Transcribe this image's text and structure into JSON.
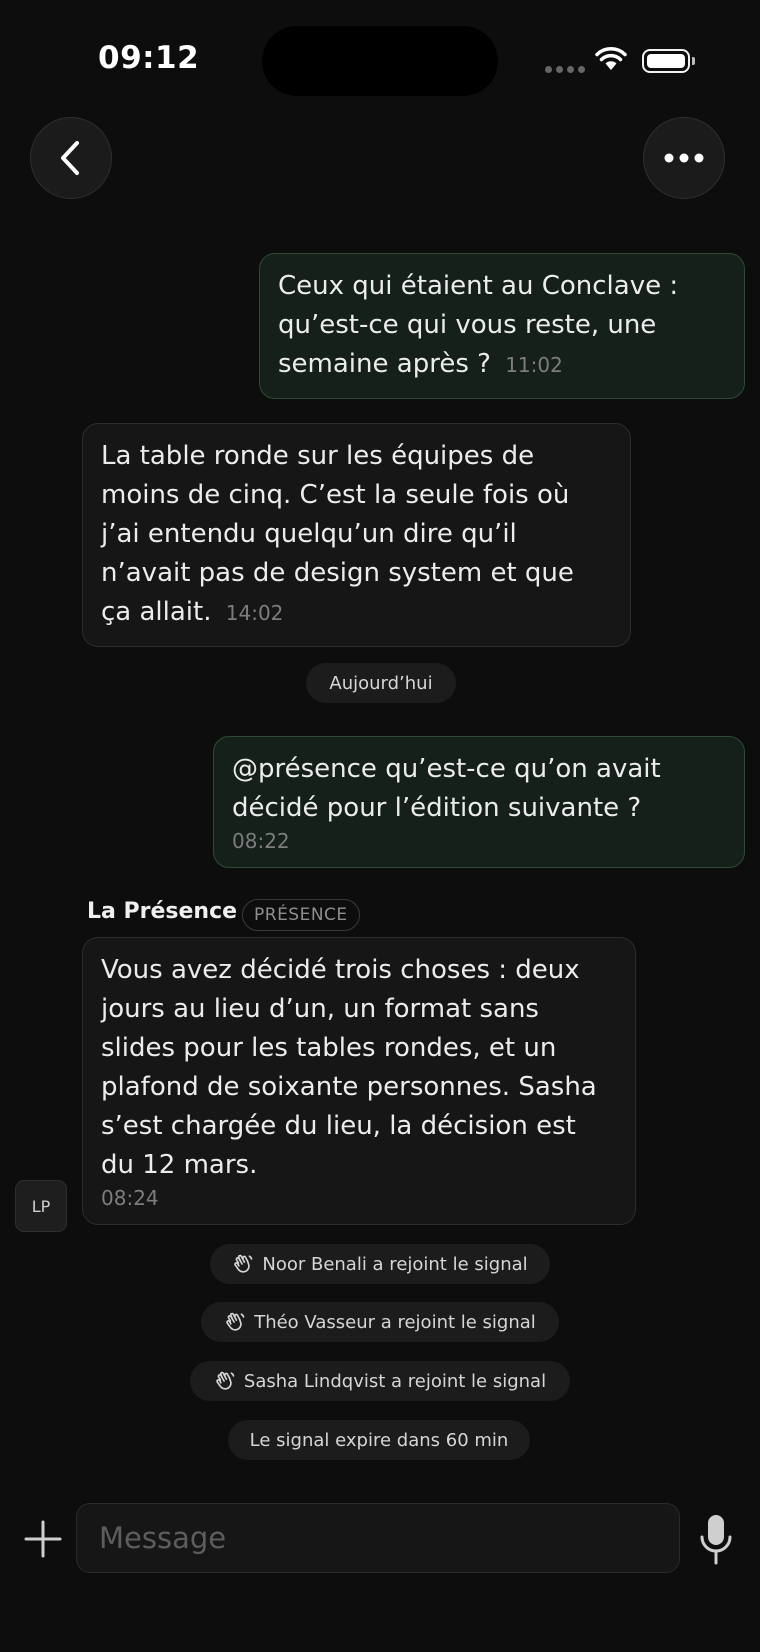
{
  "status_bar": {
    "time": "09:12"
  },
  "messages": [
    {
      "text": "Ceux qui étaient au Conclave : qu’est-ce qui vous reste, une semaine après ?",
      "time": "11:02"
    },
    {
      "text": "La table ronde sur les équipes de moins de cinq. C’est la seule fois où j’ai entendu quelqu’un dire qu’il n’avait pas de design system et que ça allait.",
      "time": "14:02"
    },
    {
      "text": "@présence qu’est-ce qu’on avait décidé pour l’édition suivante ?",
      "time": "08:22"
    },
    {
      "text": "Vous avez décidé trois choses : deux jours au lieu d’un, un format sans slides pour les tables rondes, et un plafond de soixante personnes. Sasha s’est chargée du lieu, la décision est du 12 mars.",
      "time": "08:24"
    }
  ],
  "day_separator": "Aujourd’hui",
  "assistant": {
    "name": "La Présence",
    "tag": "PRÉSENCE",
    "avatar": "LP"
  },
  "system_events": [
    "Noor Benali a rejoint le signal",
    "Théo Vasseur a rejoint le signal",
    "Sasha Lindqvist a rejoint le signal",
    "Le signal expire dans 60 min"
  ],
  "composer": {
    "placeholder": "Message"
  }
}
